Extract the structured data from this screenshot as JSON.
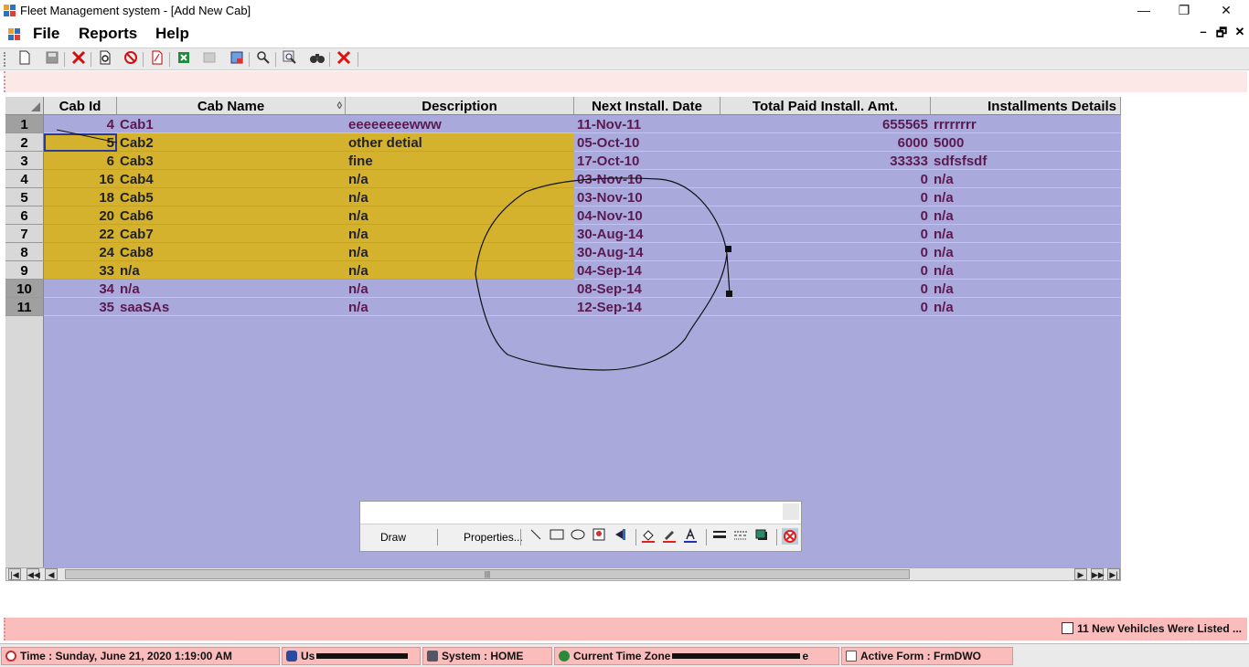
{
  "window": {
    "title": "Fleet Management system - [Add New Cab]",
    "controls": {
      "minimize": "—",
      "restore": "❐",
      "close": "✕"
    }
  },
  "menu": {
    "items": [
      "File",
      "Reports",
      "Help"
    ],
    "mdi_controls": {
      "minimize": "–",
      "restore": "🗗",
      "close": "✕"
    }
  },
  "toolbar": {
    "icons": [
      "new-icon",
      "save-icon",
      "delete-icon",
      "print-preview-icon",
      "cancel-icon",
      "pdf-icon",
      "excel-icon",
      "disabled-icon",
      "export-icon",
      "tools-icon",
      "zoom-icon",
      "binoculars-icon",
      "close-icon"
    ]
  },
  "grid": {
    "columns": [
      "Cab Id",
      "Cab Name",
      "Description",
      "Next Install. Date",
      "Total Paid Install. Amt.",
      "Installments Details"
    ],
    "sort_indicator": "◊",
    "rows": [
      {
        "num": "1",
        "cab_id": "4",
        "cab_name": "Cab1",
        "description": "eeeeeeeewww",
        "next_date": "11-Nov-11",
        "total": "655565",
        "details": "rrrrrrrr",
        "highlight": false
      },
      {
        "num": "2",
        "cab_id": "5",
        "cab_name": "Cab2",
        "description": "other detial",
        "next_date": "05-Oct-10",
        "total": "6000",
        "details": "5000",
        "highlight": true
      },
      {
        "num": "3",
        "cab_id": "6",
        "cab_name": "Cab3",
        "description": "fine",
        "next_date": "17-Oct-10",
        "total": "33333",
        "details": "sdfsfsdf",
        "highlight": true
      },
      {
        "num": "4",
        "cab_id": "16",
        "cab_name": "Cab4",
        "description": "n/a",
        "next_date": "03-Nov-10",
        "total": "0",
        "details": "n/a",
        "highlight": true
      },
      {
        "num": "5",
        "cab_id": "18",
        "cab_name": "Cab5",
        "description": "n/a",
        "next_date": "03-Nov-10",
        "total": "0",
        "details": "n/a",
        "highlight": true
      },
      {
        "num": "6",
        "cab_id": "20",
        "cab_name": "Cab6",
        "description": "n/a",
        "next_date": "04-Nov-10",
        "total": "0",
        "details": "n/a",
        "highlight": true
      },
      {
        "num": "7",
        "cab_id": "22",
        "cab_name": "Cab7",
        "description": "n/a",
        "next_date": "30-Aug-14",
        "total": "0",
        "details": "n/a",
        "highlight": true
      },
      {
        "num": "8",
        "cab_id": "24",
        "cab_name": "Cab8",
        "description": "n/a",
        "next_date": "30-Aug-14",
        "total": "0",
        "details": "n/a",
        "highlight": true
      },
      {
        "num": "9",
        "cab_id": "33",
        "cab_name": "n/a",
        "description": "n/a",
        "next_date": "04-Sep-14",
        "total": "0",
        "details": "n/a",
        "highlight": true
      },
      {
        "num": "10",
        "cab_id": "34",
        "cab_name": "n/a",
        "description": "n/a",
        "next_date": "08-Sep-14",
        "total": "0",
        "details": "n/a",
        "highlight": false
      },
      {
        "num": "11",
        "cab_id": "35",
        "cab_name": "saaSAs",
        "description": "n/a",
        "next_date": "12-Sep-14",
        "total": "0",
        "details": "n/a",
        "highlight": false
      }
    ],
    "colors": {
      "background": "#a9a9dc",
      "highlight": "#d4b22e",
      "text": "#5a1a50"
    }
  },
  "draw_toolbar": {
    "draw_label": "Draw",
    "properties_label": "Properties...",
    "tools": [
      "line-icon",
      "rectangle-icon",
      "ellipse-icon",
      "image-icon",
      "arrow-icon",
      "fill-color-icon",
      "pen-color-icon",
      "font-color-icon",
      "line-weight-icon",
      "dash-style-icon",
      "shadow-icon",
      "stop-drawing-icon"
    ]
  },
  "notification": {
    "message": "11 New Vehilcles Were Listed ..."
  },
  "status": {
    "time": "Time : Sunday, June 21, 2020 1:19:00 AM",
    "user_prefix": "Us",
    "system": "System : HOME",
    "timezone_prefix": "Current Time Zone",
    "timezone_visible_suffix": "e",
    "active_form": "Active Form : FrmDWO"
  }
}
